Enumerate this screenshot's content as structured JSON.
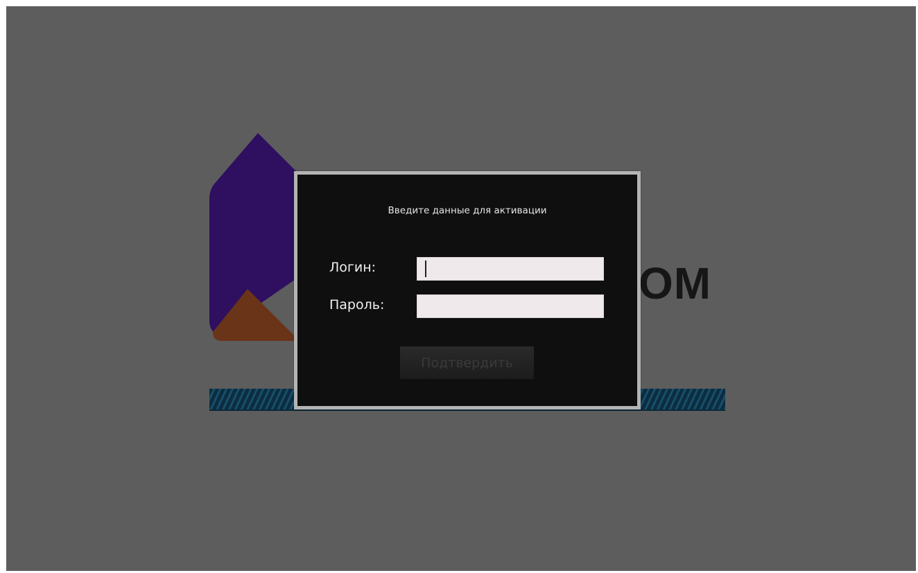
{
  "background": {
    "color": "#5d5d5d",
    "logo": {
      "wordmark_visible": "ОМ",
      "mark_colors": [
        "#2f0f60",
        "#6a3418"
      ],
      "stripe_color": "#174f6a"
    }
  },
  "dialog": {
    "title": "Введите данные для активации",
    "login_label": "Логин:",
    "login_value": "",
    "password_label": "Пароль:",
    "password_value": "",
    "submit_label": "Подтвердить",
    "submit_enabled": false
  }
}
